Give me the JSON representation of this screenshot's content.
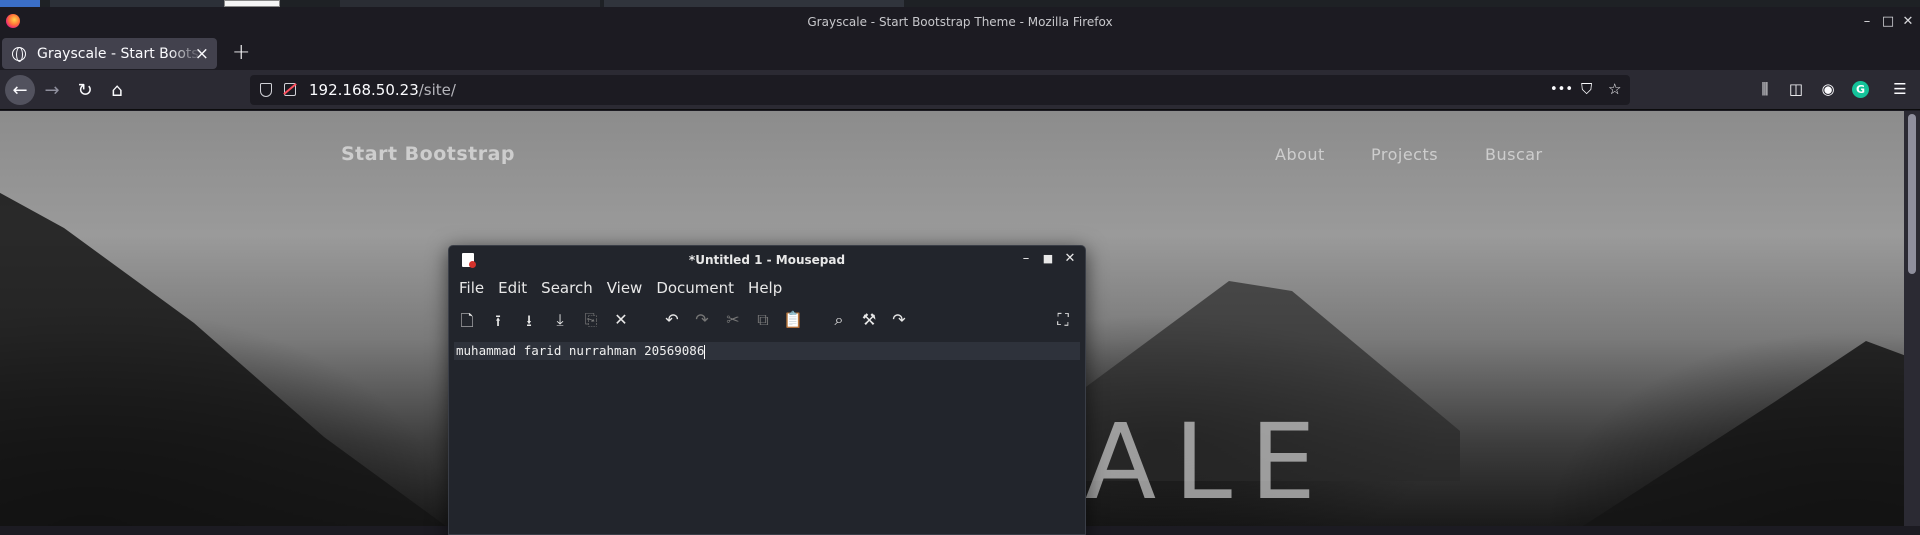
{
  "window": {
    "title": "Grayscale - Start Bootstrap Theme - Mozilla Firefox"
  },
  "tab": {
    "title": "Grayscale - Start Bootstrap Theme",
    "close": "×",
    "new_tab": "+"
  },
  "nav": {
    "back": "←",
    "forward": "→",
    "reload": "↻",
    "home": "⌂"
  },
  "urlbar": {
    "host": "192.168.50.23",
    "path": "/site/",
    "more": "•••"
  },
  "page": {
    "brand": "Start Bootstrap",
    "links": [
      "About",
      "Projects",
      "Buscar"
    ],
    "hero_text": "ALE"
  },
  "mousepad": {
    "title": "*Untitled 1 - Mousepad",
    "menu": [
      "File",
      "Edit",
      "Search",
      "View",
      "Document",
      "Help"
    ],
    "text": "muhammad farid nurrahman 20569086"
  },
  "colors": {
    "accent": "#15c39a",
    "urlbar_bg": "#1c1b22",
    "toolbar_bg": "#2b2a33"
  }
}
